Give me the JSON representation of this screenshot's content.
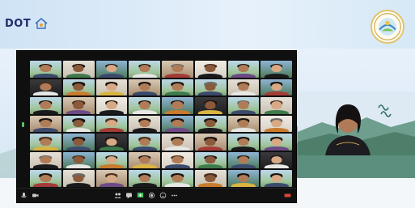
{
  "app": {
    "logo_text": "DOT",
    "icons": {
      "left_logo": "house-icon",
      "seal": "emblem-seal-icon"
    }
  },
  "meeting": {
    "grid": {
      "columns": 8,
      "rows": 7,
      "participant_tile_count": 56
    },
    "toolbar_icons": [
      "mic-icon",
      "video-icon",
      "participants-icon",
      "chat-icon",
      "share-screen-icon",
      "record-icon",
      "reactions-icon",
      "more-icon",
      "leave-icon"
    ]
  },
  "colors": {
    "banner_start": "#cfe3f5",
    "banner_end": "#d6e8f6",
    "logo_text": "#1f2e6b",
    "seal_border": "#e5c36a",
    "zoom_bg": "#0f0f10",
    "active_indicator": "#5fbf6a"
  }
}
